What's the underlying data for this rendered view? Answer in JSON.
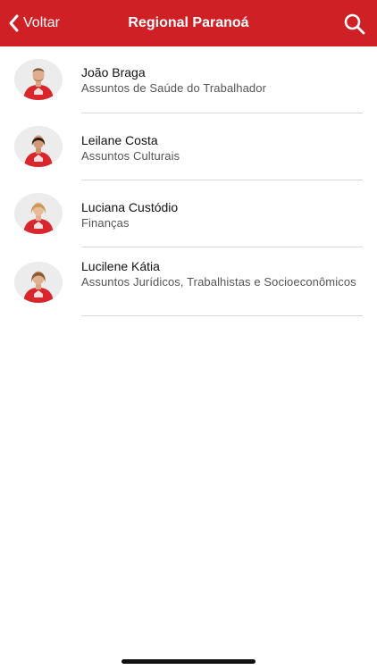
{
  "navbar": {
    "back_label": "Voltar",
    "title": "Regional Paranoá",
    "accent_color": "#cf2026",
    "back_icon": "chevron-left-icon",
    "search_icon": "search-icon"
  },
  "members": [
    {
      "name": "João Braga",
      "role": "Assuntos de Saúde do Trabalhador"
    },
    {
      "name": "Leilane Costa",
      "role": "Assuntos Culturais"
    },
    {
      "name": "Luciana Custódio",
      "role": "Finanças"
    },
    {
      "name": "Lucilene Kátia",
      "role": "Assuntos Jurídicos, Trabalhistas e Socioeconômicos"
    }
  ]
}
